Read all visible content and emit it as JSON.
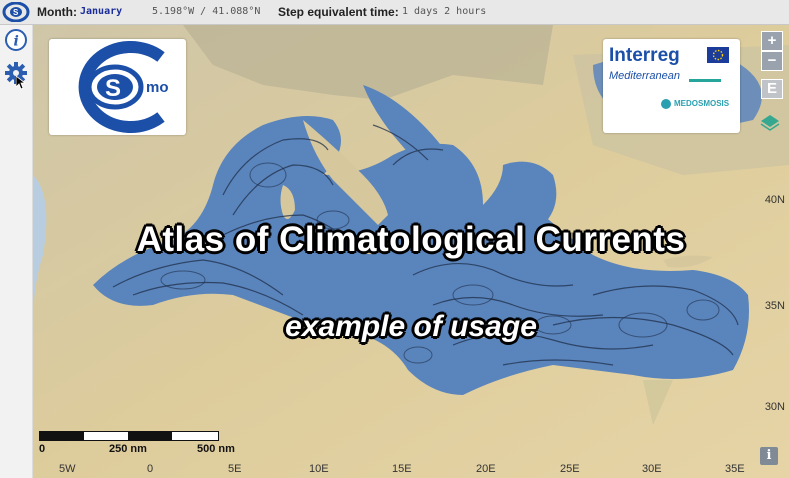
{
  "topbar": {
    "month_label": "Month:",
    "month_value": "January",
    "coords": "5.198°W / 41.088°N",
    "step_label": "Step equivalent time:",
    "step_value": "1 days 2 hours"
  },
  "sidebar": {
    "icons": [
      "info-icon",
      "gear-icon"
    ]
  },
  "overlay": {
    "title": "Atlas of Climatological Currents",
    "subtitle": "example of usage"
  },
  "logos": {
    "csmo_text": "mo",
    "csmo_letter": "S",
    "interreg": "Interreg",
    "mediterranean": "Mediterranean",
    "project": "MEDOSMOSIS"
  },
  "map_controls": {
    "zoom_in": "+",
    "zoom_out": "−",
    "layer_label": "E",
    "info": "i"
  },
  "latitudes": [
    "40N",
    "35N",
    "30N"
  ],
  "longitudes": [
    "5W",
    "0",
    "5E",
    "10E",
    "15E",
    "20E",
    "25E",
    "30E",
    "35E"
  ],
  "scale": {
    "zero": "0",
    "mid": "250 nm",
    "end": "500 nm"
  },
  "colors": {
    "sea": "#5a84bc",
    "land": "#d9c9a0",
    "brand_blue": "#1b4fa8"
  }
}
